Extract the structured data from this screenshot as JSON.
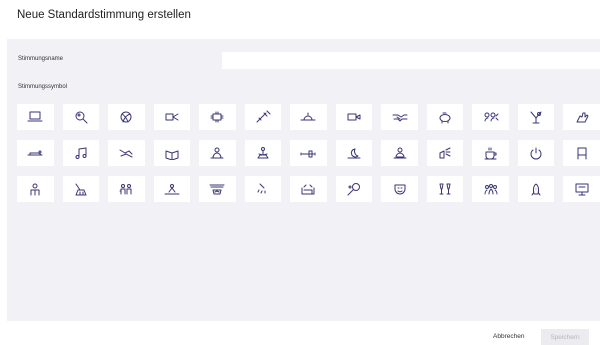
{
  "dialog": {
    "title": "Neue Standardstimmung erstellen",
    "name_label": "Stimmungsname",
    "name_value": "",
    "name_placeholder": "",
    "symbol_label": "Stimmungssymbol",
    "cancel_label": "Abbrechen",
    "save_label": "Speichern"
  },
  "colors": {
    "icon_stroke": "#3a3675",
    "panel_bg": "#f2f2f6",
    "tile_bg": "#ffffff",
    "save_disabled_bg": "#ececf0",
    "save_disabled_text": "#b4b4bc"
  },
  "symbols": [
    [
      "laptop-icon",
      "search-people-icon",
      "ball-icon",
      "projector-icon",
      "conference-table-icon",
      "syringe-icon",
      "sunrise-icon",
      "camera-icon",
      "handshake-icon",
      "piggy-bank-icon",
      "meeting-icon",
      "wine-glass-icon",
      "hand-icon"
    ],
    [
      "lying-person-icon",
      "music-note-icon",
      "relax-icon",
      "reading-book-icon",
      "baby-icon",
      "meditation-icon",
      "dumbbell-icon",
      "sleep-moon-icon",
      "person-desk-icon",
      "cleaning-icon",
      "coffee-cup-icon",
      "power-icon",
      "chair-icon"
    ],
    [
      "person-icon",
      "broom-icon",
      "family-icon",
      "picnic-icon",
      "fireplace-icon",
      "shower-icon",
      "sofa-icon",
      "ping-pong-icon",
      "theater-masks-icon",
      "wine-toast-icon",
      "group-icon",
      "rocket-icon",
      "computer-screen-icon"
    ]
  ]
}
